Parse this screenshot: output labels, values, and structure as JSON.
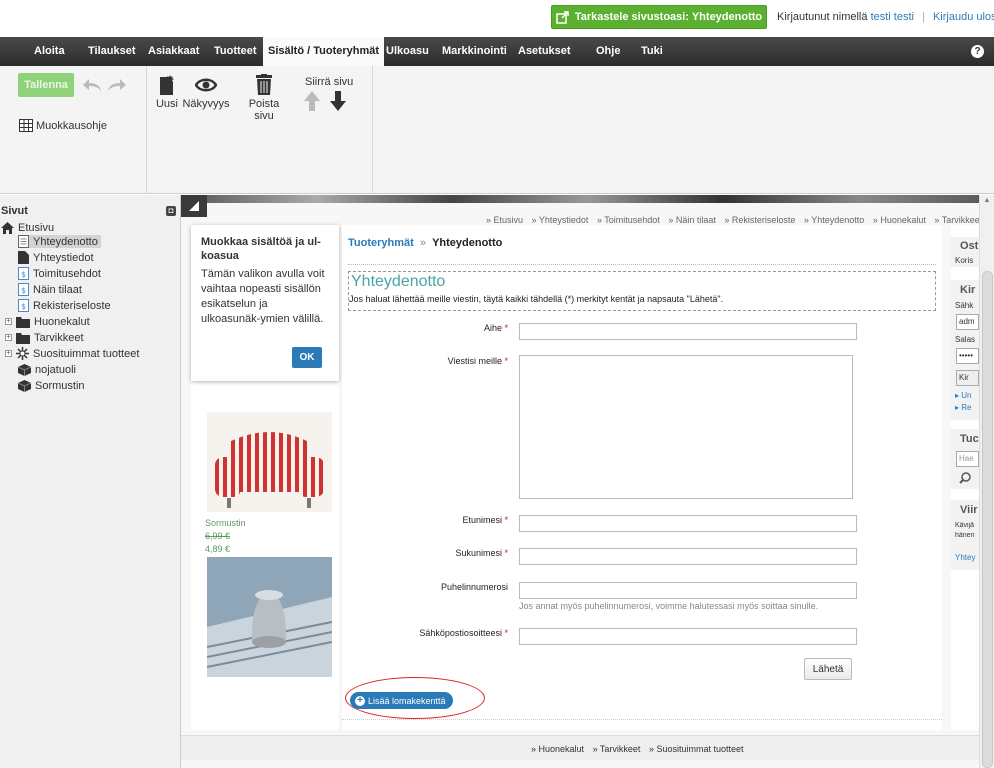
{
  "topbar": {
    "view_site": "Tarkastele sivustoasi: Yhteydenotto",
    "logged_in_prefix": "Kirjautunut nimellä",
    "user_name": "testi testi",
    "separator": "|",
    "logout": "Kirjaudu ulos"
  },
  "menu": {
    "items": [
      "Aloita",
      "Tilaukset",
      "Asiakkaat",
      "Tuotteet",
      "Sisältö / Tuoteryhmät",
      "Ulkoasu",
      "Markkinointi",
      "Asetukset",
      "Ohje",
      "Tuki"
    ],
    "help": "?"
  },
  "ribbon": {
    "save": "Tallenna",
    "edit_help": "Muokkausohje",
    "new": "Uusi",
    "preview": "Näkyvyys",
    "delete": "Poista sivu",
    "move": "Siirrä sivu"
  },
  "sidebar": {
    "title": "Sivut",
    "collapse": "◘",
    "tree": [
      {
        "label": "Etusivu",
        "icon": "home-icon"
      },
      {
        "label": "Yhteydenotto",
        "icon": "page-icon"
      },
      {
        "label": "Yhteystiedot",
        "icon": "page-icon"
      },
      {
        "label": "Toimitusehdot",
        "icon": "page-dollar-icon"
      },
      {
        "label": "Näin tilaat",
        "icon": "page-dollar-icon"
      },
      {
        "label": "Rekisteriseloste",
        "icon": "page-dollar-icon"
      },
      {
        "label": "Huonekalut",
        "icon": "folder-icon"
      },
      {
        "label": "Tarvikkeet",
        "icon": "folder-icon"
      },
      {
        "label": "Suosituimmat tuotteet",
        "icon": "star-icon"
      },
      {
        "label": "nojatuoli",
        "icon": "box-icon"
      },
      {
        "label": "Sormustin",
        "icon": "box-icon"
      }
    ]
  },
  "top_breadcrumb": [
    "» Etusivu",
    "» Yhteystiedot",
    "» Toimitusehdot",
    "» Näin tilaat",
    "» Rekisteriseloste",
    "» Yhteydenotto",
    "» Huonekalut",
    "» Tarvikkeet"
  ],
  "popup": {
    "title": "Muokkaa sisältöä ja ul-koasua",
    "text": "Tämän valikon avulla voit vaihtaa nopeasti sisällön esikatselun ja ulkoasunäk-ymien välillä.",
    "ok": "OK"
  },
  "product": {
    "name": "Sormustin",
    "old_price": "6,99 €",
    "new_price": "4,89 €"
  },
  "breadcrumb": {
    "parent": "Tuoteryhmät",
    "sep": "»",
    "current": "Yhteydenotto"
  },
  "page": {
    "title": "Yhteydenotto",
    "intro": "Jos haluat lähettää meille viestin, täytä kaikki tähdellä (*) merkityt kentät ja napsauta \"Lähetä\"."
  },
  "form": {
    "subject": "Aihe",
    "message": "Viestisi meille",
    "first_name": "Etunimesi",
    "last_name": "Sukunimesi",
    "phone": "Puhelinnumerosi",
    "phone_hint": "Jos annat myös puhelinnumerosi, voimme halutessasi myös soittaa sinulle.",
    "email": "Sähköpostiosoitteesi",
    "required_mark": "*",
    "submit": "Lähetä",
    "add_field": "Lisää lomakekenttä"
  },
  "right_col": {
    "cart_title": "Ost",
    "cart_text": "Koris",
    "login_title": "Kir",
    "email_label": "Sähk",
    "email_value": "adm",
    "password_label": "Salas",
    "password_value": "•••••",
    "login_btn": "Kir",
    "link1": "▸ Un",
    "link2": "▸ Re",
    "search_title": "Tuc",
    "search_placeholder": "Hae",
    "viimeisimmat_title": "Viir",
    "recent_text1": "Kävijä",
    "recent_text2": "hänen",
    "recent_link": "Yhtey"
  },
  "footer_breadcrumb": [
    "» Huonekalut",
    "» Tarvikkeet",
    "» Suosituimmat tuotteet"
  ],
  "colors": {
    "green": "#5bb12f",
    "blue": "#2a7ab8",
    "teal_title": "#46a5a5",
    "menu_dark": "#2b2b2b"
  }
}
